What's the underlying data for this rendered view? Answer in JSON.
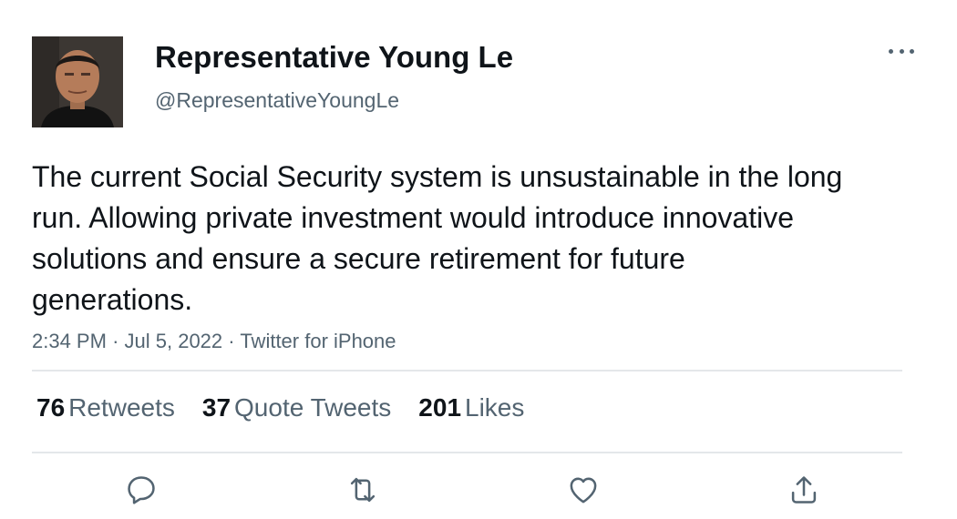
{
  "author": {
    "display_name": "Representative Young Le",
    "handle": "@RepresentativeYoungLe",
    "avatar_icon": "profile-photo"
  },
  "tweet": {
    "text": "The current Social Security system is unsustainable in the long run. Allowing private investment would introduce innovative solutions and ensure a secure retirement for future generations.",
    "time": "2:34 PM",
    "date": "Jul 5, 2022",
    "source": "Twitter for iPhone",
    "separator": "·"
  },
  "stats": {
    "retweets_count": "76",
    "retweets_label": "Retweets",
    "quotes_count": "37",
    "quotes_label": "Quote Tweets",
    "likes_count": "201",
    "likes_label": "Likes"
  },
  "actions": [
    "reply-icon",
    "retweet-icon",
    "like-icon",
    "share-icon"
  ],
  "colors": {
    "text": "#0f1419",
    "secondary_text": "#536471",
    "divider": "#e4e7ea",
    "icon": "#536471"
  }
}
